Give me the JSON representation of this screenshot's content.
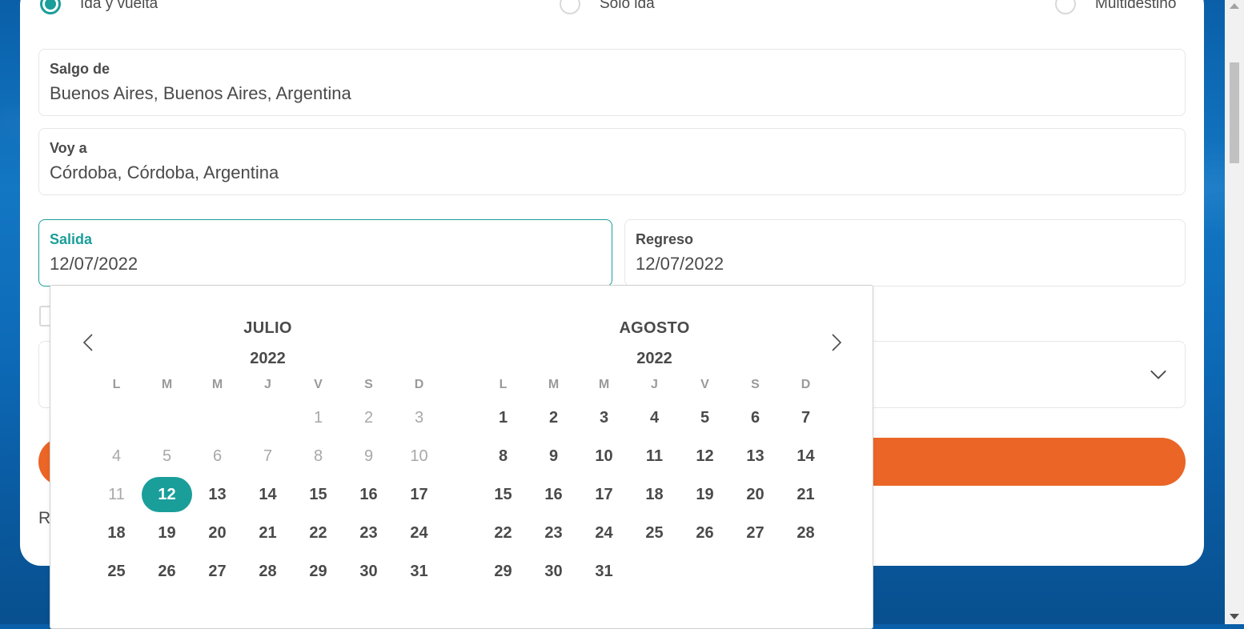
{
  "trip_type": {
    "options": [
      {
        "label": "Ida y vuelta",
        "selected": true
      },
      {
        "label": "Solo ida",
        "selected": false
      },
      {
        "label": "Multidestino",
        "selected": false
      }
    ]
  },
  "origin": {
    "label": "Salgo de",
    "value": "Buenos Aires, Buenos Aires, Argentina"
  },
  "destination": {
    "label": "Voy a",
    "value": "Córdoba, Córdoba, Argentina"
  },
  "departure": {
    "label": "Salida",
    "value": "12/07/2022"
  },
  "return": {
    "label": "Regreso",
    "value": "12/07/2022"
  },
  "below_text": "R",
  "colors": {
    "accent": "#1a9e9a",
    "search_button": "#ea6526",
    "text": "#4a4a4a",
    "disabled": "#a8a8a8"
  },
  "calendar": {
    "prev_icon": "chevron-left-icon",
    "next_icon": "chevron-right-icon",
    "months": [
      {
        "name": "JULIO",
        "year": "2022",
        "weekdays": [
          "L",
          "M",
          "M",
          "J",
          "V",
          "S",
          "D"
        ],
        "first_weekday_index": 4,
        "days_in_month": 31,
        "disabled_through": 11,
        "selected_day": 12
      },
      {
        "name": "AGOSTO",
        "year": "2022",
        "weekdays": [
          "L",
          "M",
          "M",
          "J",
          "V",
          "S",
          "D"
        ],
        "first_weekday_index": 0,
        "days_in_month": 31,
        "disabled_through": 0,
        "selected_day": null
      }
    ]
  }
}
